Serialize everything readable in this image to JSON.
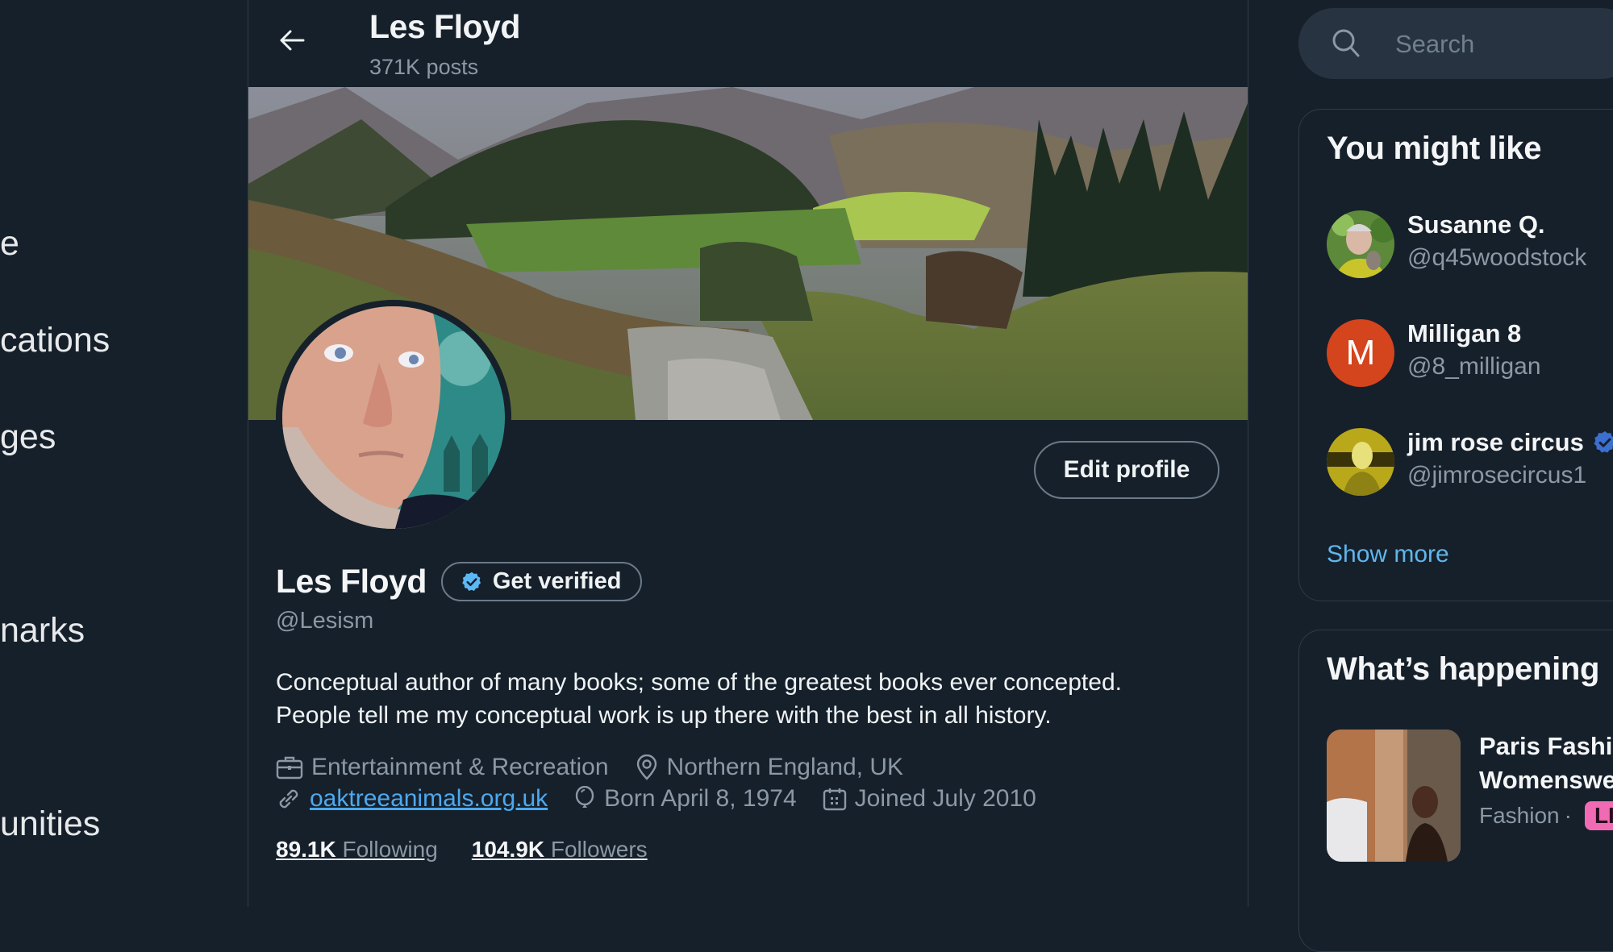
{
  "sidebar": {
    "items": [
      {
        "label": "Home",
        "visible_fragment": "e"
      },
      {
        "label": "Notifications",
        "visible_fragment": "cations"
      },
      {
        "label": "Messages",
        "visible_fragment": "ges"
      },
      {
        "label": "Bookmarks",
        "visible_fragment": "narks"
      },
      {
        "label": "Communities",
        "visible_fragment": "unities"
      }
    ]
  },
  "header": {
    "back_icon": "arrow-left-icon",
    "title": "Les Floyd",
    "subtitle": "371K posts"
  },
  "profile": {
    "name": "Les Floyd",
    "handle": "@Lesism",
    "edit_label": "Edit profile",
    "verify_label": "Get verified",
    "verify_icon": "verified-badge-icon",
    "bio_line1": "Conceptual author of many books; some of the greatest books ever concepted.",
    "bio_line2": "People tell me my conceptual work is up there with the best in all history.",
    "category": "Entertainment & Recreation",
    "location": "Northern England, UK",
    "website": "oaktreeanimals.org.uk",
    "born": "Born April 8, 1974",
    "joined": "Joined July 2010",
    "following_count": "89.1K",
    "following_label": "Following",
    "followers_count": "104.9K",
    "followers_label": "Followers"
  },
  "search": {
    "placeholder": "Search",
    "icon": "search-icon"
  },
  "you_might_like": {
    "title": "You might like",
    "users": [
      {
        "name": "Susanne Q.",
        "handle": "@q45woodstock",
        "verified": false
      },
      {
        "name": "Milligan 8",
        "handle": "@8_milligan",
        "initial": "M",
        "avatar_color": "#d4441d",
        "verified": false
      },
      {
        "name": "jim rose circus",
        "handle": "@jimrosecircus1",
        "verified": true
      }
    ],
    "show_more": "Show more"
  },
  "whats_happening": {
    "title": "What’s happening",
    "trends": [
      {
        "title_line1": "Paris Fashion",
        "title_line2": "Womenswear",
        "category": "Fashion",
        "separator": "·",
        "badge": "LIVE",
        "badge_color": "#f06bb3"
      }
    ]
  },
  "colors": {
    "background": "#16202b",
    "accent": "#1d9bf0",
    "link": "#4ca9ef",
    "muted_text": "#8b98a5",
    "border": "#2f3b47"
  }
}
